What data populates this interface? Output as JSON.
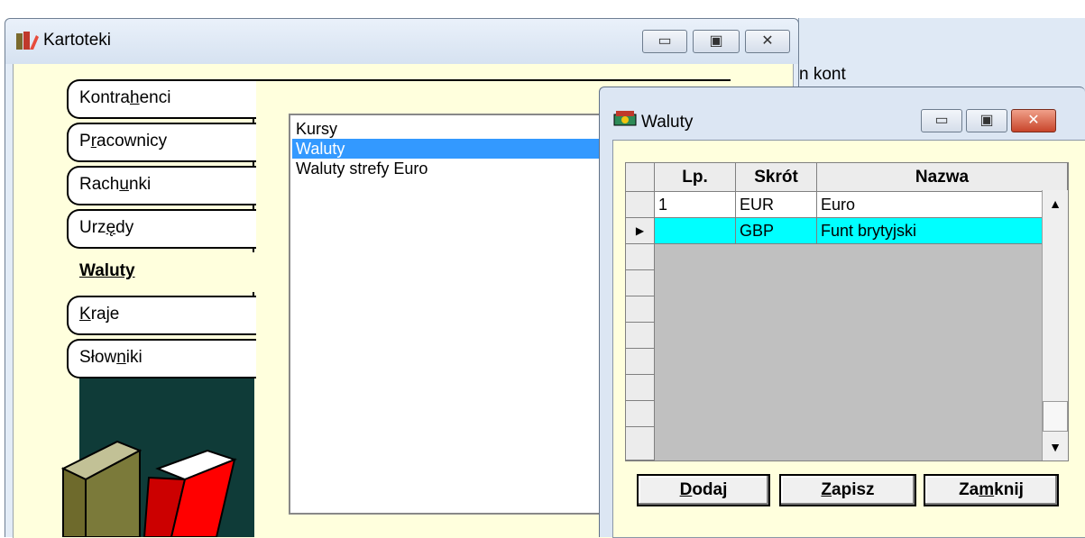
{
  "background_window": {
    "title_partial": "n kont"
  },
  "kartoteki": {
    "title": "Kartoteki",
    "tabs": [
      {
        "pre": "Kontra",
        "u": "h",
        "post": "enci"
      },
      {
        "pre": "P",
        "u": "r",
        "post": "acownicy"
      },
      {
        "pre": "Rach",
        "u": "u",
        "post": "nki"
      },
      {
        "pre": "Urz",
        "u": "ę",
        "post": "dy"
      },
      {
        "pre": "",
        "u": "W",
        "post": "aluty"
      },
      {
        "pre": "",
        "u": "K",
        "post": "raje"
      },
      {
        "pre": "Słow",
        "u": "n",
        "post": "iki"
      }
    ],
    "active_tab": "Waluty",
    "list_items": [
      "Kursy",
      "Waluty",
      "Waluty strefy Euro"
    ],
    "selected_item": "Waluty"
  },
  "waluty": {
    "title": "Waluty",
    "columns": [
      "Lp.",
      "Skrót",
      "Nazwa"
    ],
    "rows": [
      {
        "lp": "1",
        "skrot": "EUR",
        "nazwa": "Euro"
      },
      {
        "lp": "",
        "skrot": "GBP",
        "nazwa": "Funt brytyjski"
      }
    ],
    "current_row_marker": "▶",
    "buttons": {
      "dodaj": {
        "u": "D",
        "post": "odaj"
      },
      "zapisz": {
        "u": "Z",
        "post": "apisz"
      },
      "zamknij": {
        "pre": "Za",
        "u": "m",
        "post": "knij"
      }
    }
  },
  "colors": {
    "selection": "#3399ff",
    "grid_selected_row": "#00ffff",
    "tab_area": "#ffffdd",
    "book_panel": "#0f3b38"
  }
}
